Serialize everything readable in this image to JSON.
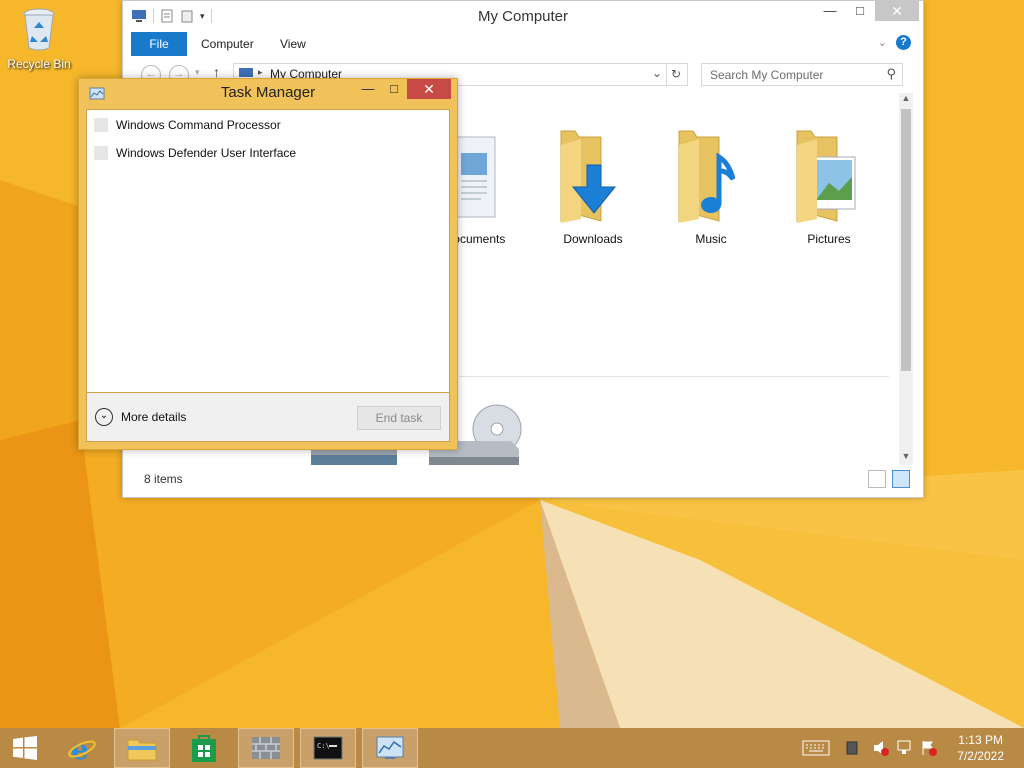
{
  "desktop": {
    "recycle_bin_label": "Recycle Bin"
  },
  "explorer": {
    "title": "My Computer",
    "ribbon_tabs": [
      "File",
      "Computer",
      "View"
    ],
    "address_path": "My Computer",
    "search_placeholder": "Search My Computer",
    "folders": [
      {
        "name": "Documents",
        "icon": "documents-folder-icon"
      },
      {
        "name": "Downloads",
        "icon": "downloads-folder-icon"
      },
      {
        "name": "Music",
        "icon": "music-folder-icon"
      },
      {
        "name": "Pictures",
        "icon": "pictures-folder-icon"
      }
    ],
    "status_items": "8 items",
    "window_buttons": {
      "minimize": "—",
      "maximize": "□",
      "close": "✕"
    }
  },
  "task_manager": {
    "title": "Task Manager",
    "processes": [
      "Windows Command Processor",
      "Windows Defender User Interface"
    ],
    "more_details_label": "More details",
    "end_task_label": "End task",
    "window_buttons": {
      "minimize": "—",
      "maximize": "□",
      "close": "✕"
    }
  },
  "taskbar": {
    "clock_time": "1:13 PM",
    "clock_date": "7/2/2022",
    "apps": [
      "start",
      "internet-explorer",
      "file-explorer",
      "store",
      "firewall",
      "command-prompt",
      "task-manager"
    ]
  },
  "colors": {
    "wallpaper": "#f5b325",
    "taskbar": "#b98a46",
    "file_tab": "#1979ca",
    "tm_frame": "#f1c15a",
    "tm_close": "#c74a46"
  }
}
